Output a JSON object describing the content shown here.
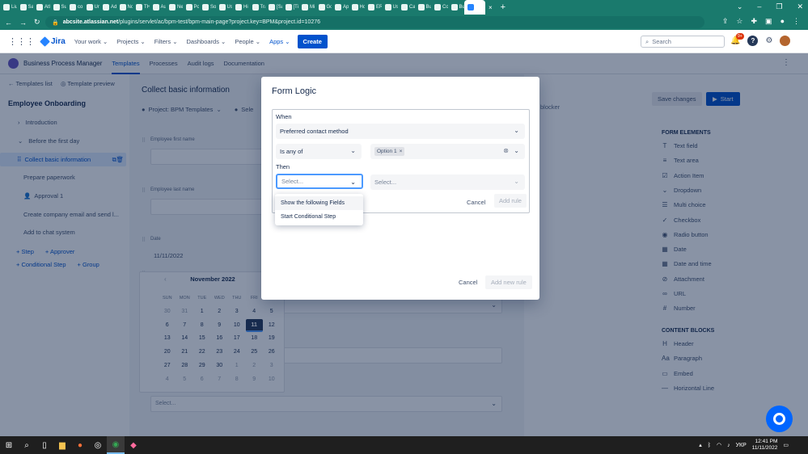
{
  "browser": {
    "tabs": [
      "Liu",
      "Sa",
      "Atl",
      "Sul",
      "co",
      "Un",
      "Ad",
      "No",
      "TH",
      "Au",
      "Ne",
      "Po",
      "Sol",
      "Us",
      "Hi",
      "Tra",
      "[Sa",
      "[Ti",
      "Mi",
      "Go",
      "Ap",
      "Ho",
      "ER",
      "Us",
      "Ca",
      "Bu",
      "Co",
      "Bu"
    ],
    "url_domain": "abcsite.atlassian.net",
    "url_path": "/plugins/servlet/ac/bpm-test/bpm-main-page?project.key=BPM&project.id=10276"
  },
  "topnav": {
    "product": "Jira",
    "items": [
      "Your work ⌄",
      "Projects ⌄",
      "Filters ⌄",
      "Dashboards ⌄",
      "People ⌄",
      "Apps ⌄"
    ],
    "create_label": "Create",
    "search_placeholder": "Search",
    "notif_badge": "9+"
  },
  "appbar": {
    "name": "Business Process Manager",
    "tabs": [
      "Templates",
      "Processes",
      "Audit logs",
      "Documentation"
    ]
  },
  "sidebar": {
    "back_link": "Templates list",
    "preview_link": "Template preview",
    "workflow_title": "Employee Onboarding",
    "items": [
      {
        "label": "Introduction"
      },
      {
        "label": "Before the first day"
      },
      {
        "label": "Collect basic information"
      },
      {
        "label": "Prepare paperwork"
      },
      {
        "label": "Approval 1"
      },
      {
        "label": "Create company email and send l..."
      },
      {
        "label": "Add to chat system"
      }
    ],
    "add_step": "+ Step",
    "add_approver": "+ Approver",
    "add_conditional": "+ Conditional Step",
    "add_group": "+ Group"
  },
  "main": {
    "title": "Collect basic information",
    "project": "Project: BPM Templates",
    "selector_partial": "Sele",
    "fields": {
      "first_name": "Employee first name",
      "last_name": "Employee last name",
      "date": "Date",
      "date_value": "11/11/2022",
      "bottom_select": "Select..."
    }
  },
  "calendar": {
    "month": "November 2022",
    "dow": [
      "SUN",
      "MON",
      "TUE",
      "WED",
      "THU",
      "FRI",
      "SAT"
    ],
    "days": [
      "30",
      "31",
      "1",
      "2",
      "3",
      "4",
      "5",
      "6",
      "7",
      "8",
      "9",
      "10",
      "11",
      "12",
      "13",
      "14",
      "15",
      "16",
      "17",
      "18",
      "19",
      "20",
      "21",
      "22",
      "23",
      "24",
      "25",
      "26",
      "27",
      "28",
      "29",
      "30",
      "1",
      "2",
      "3",
      "4",
      "5",
      "6",
      "7",
      "8",
      "9",
      "10"
    ],
    "muted_indices": [
      0,
      1,
      32,
      33,
      34,
      35,
      36,
      37,
      38,
      39,
      40,
      41
    ],
    "selected_index": 12
  },
  "rightpanel": {
    "save_changes": "Save changes",
    "start": "Start",
    "blocker": "blocker",
    "form_elements_head": "FORM ELEMENTS",
    "form_elements": [
      {
        "label": "Text field",
        "icon": "T"
      },
      {
        "label": "Text area",
        "icon": "≡"
      },
      {
        "label": "Action Item",
        "icon": "☑"
      },
      {
        "label": "Dropdown",
        "icon": "⌄"
      },
      {
        "label": "Multi choice",
        "icon": "☰"
      },
      {
        "label": "Checkbox",
        "icon": "✓"
      },
      {
        "label": "Radio button",
        "icon": "◉"
      },
      {
        "label": "Date",
        "icon": "▦"
      },
      {
        "label": "Date and time",
        "icon": "▦"
      },
      {
        "label": "Attachment",
        "icon": "⊘"
      },
      {
        "label": "URL",
        "icon": "∞"
      },
      {
        "label": "Number",
        "icon": "#"
      }
    ],
    "content_blocks_head": "CONTENT BLOCKS",
    "content_blocks": [
      {
        "label": "Header",
        "icon": "H"
      },
      {
        "label": "Paragraph",
        "icon": "Aa"
      },
      {
        "label": "Embed",
        "icon": "▭"
      },
      {
        "label": "Horizontal Line",
        "icon": "—"
      }
    ]
  },
  "modal": {
    "title": "Form Logic",
    "when_label": "When",
    "when_field": "Preferred contact method",
    "operator": "Is any of",
    "chip": "Option 1",
    "then_label": "Then",
    "then_action_placeholder": "Select...",
    "then_target_placeholder": "Select...",
    "dropdown_options": [
      "Show the following Fields",
      "Start Conditional Step"
    ],
    "rule_cancel": "Cancel",
    "add_rule": "Add rule",
    "cancel": "Cancel",
    "add_new_rule": "Add new rule"
  },
  "taskbar": {
    "lang": "УКР",
    "time": "12:41 PM",
    "date": "11/11/2022"
  }
}
